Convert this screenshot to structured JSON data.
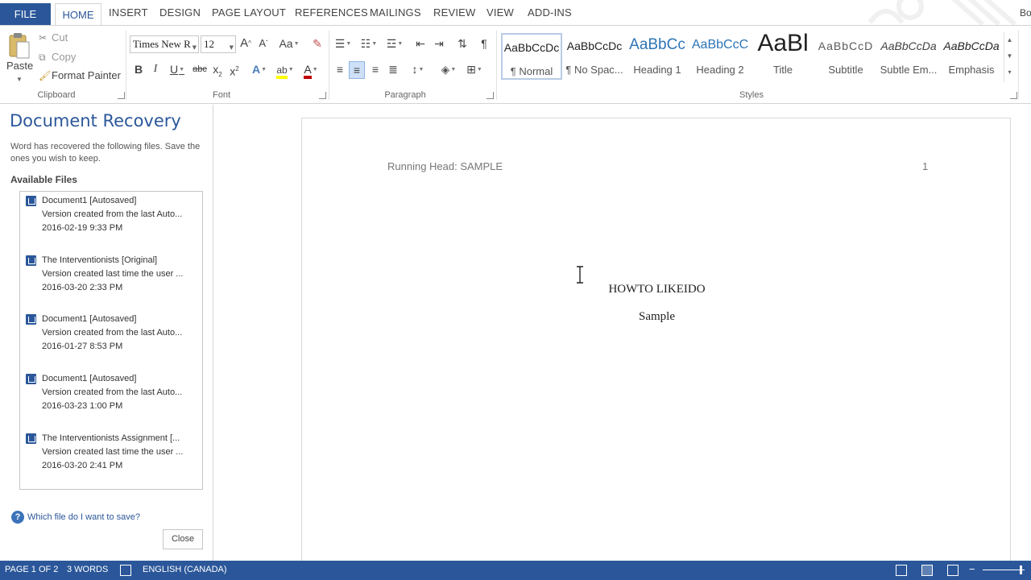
{
  "ribbon": {
    "tabs": [
      "FILE",
      "HOME",
      "INSERT",
      "DESIGN",
      "PAGE LAYOUT",
      "REFERENCES",
      "MAILINGS",
      "REVIEW",
      "VIEW",
      "ADD-INS"
    ],
    "account": "Bo",
    "clipboard": {
      "paste": "Paste",
      "cut": "Cut",
      "copy": "Copy",
      "format_painter": "Format Painter",
      "group_label": "Clipboard"
    },
    "font": {
      "name": "Times New R",
      "size": "12",
      "grow": "A",
      "shrink": "A",
      "change_case": "Aa",
      "bold": "B",
      "italic": "I",
      "underline": "U",
      "strikethrough": "abc",
      "subscript": "x",
      "superscript": "x",
      "group_label": "Font"
    },
    "paragraph": {
      "group_label": "Paragraph",
      "pilcrow": "¶"
    },
    "styles": {
      "group_label": "Styles",
      "items": [
        {
          "preview": "AaBbCcDc",
          "name": "¶ Normal"
        },
        {
          "preview": "AaBbCcDc",
          "name": "¶ No Spac..."
        },
        {
          "preview": "AaBbCc",
          "name": "Heading 1"
        },
        {
          "preview": "AaBbCcC",
          "name": "Heading 2"
        },
        {
          "preview": "AaBl",
          "name": "Title"
        },
        {
          "preview": "AaBbCcD",
          "name": "Subtitle"
        },
        {
          "preview": "AaBbCcDa",
          "name": "Subtle Em..."
        },
        {
          "preview": "AaBbCcDa",
          "name": "Emphasis"
        }
      ]
    }
  },
  "recovery": {
    "title": "Document Recovery",
    "description": "Word has recovered the following files.  Save the ones you wish to keep.",
    "available_label": "Available Files",
    "files": [
      {
        "name": "Document1  [Autosaved]",
        "detail": "Version created from the last Auto...",
        "date": "2016-02-19 9:33 PM"
      },
      {
        "name": "The Interventionists  [Original]",
        "detail": "Version created last time the user ...",
        "date": "2016-03-20 2:33 PM"
      },
      {
        "name": "Document1  [Autosaved]",
        "detail": "Version created from the last Auto...",
        "date": "2016-01-27 8:53 PM"
      },
      {
        "name": "Document1  [Autosaved]",
        "detail": "Version created from the last Auto...",
        "date": "2016-03-23 1:00 PM"
      },
      {
        "name": "The Interventionists Assignment  [...",
        "detail": "Version created last time the user ...",
        "date": "2016-03-20 2:41 PM"
      }
    ],
    "help_link": "Which file do I want to save?",
    "close_label": "Close"
  },
  "document": {
    "running_head": "Running Head: SAMPLE",
    "page_number": "1",
    "title": "HOWTO LIKEIDO",
    "subtitle": "Sample"
  },
  "status": {
    "page": "PAGE 1 OF 2",
    "words": "3 WORDS",
    "language": "ENGLISH (CANADA)"
  },
  "colors": {
    "accent": "#2b579a",
    "status_bar": "#2b579a"
  }
}
